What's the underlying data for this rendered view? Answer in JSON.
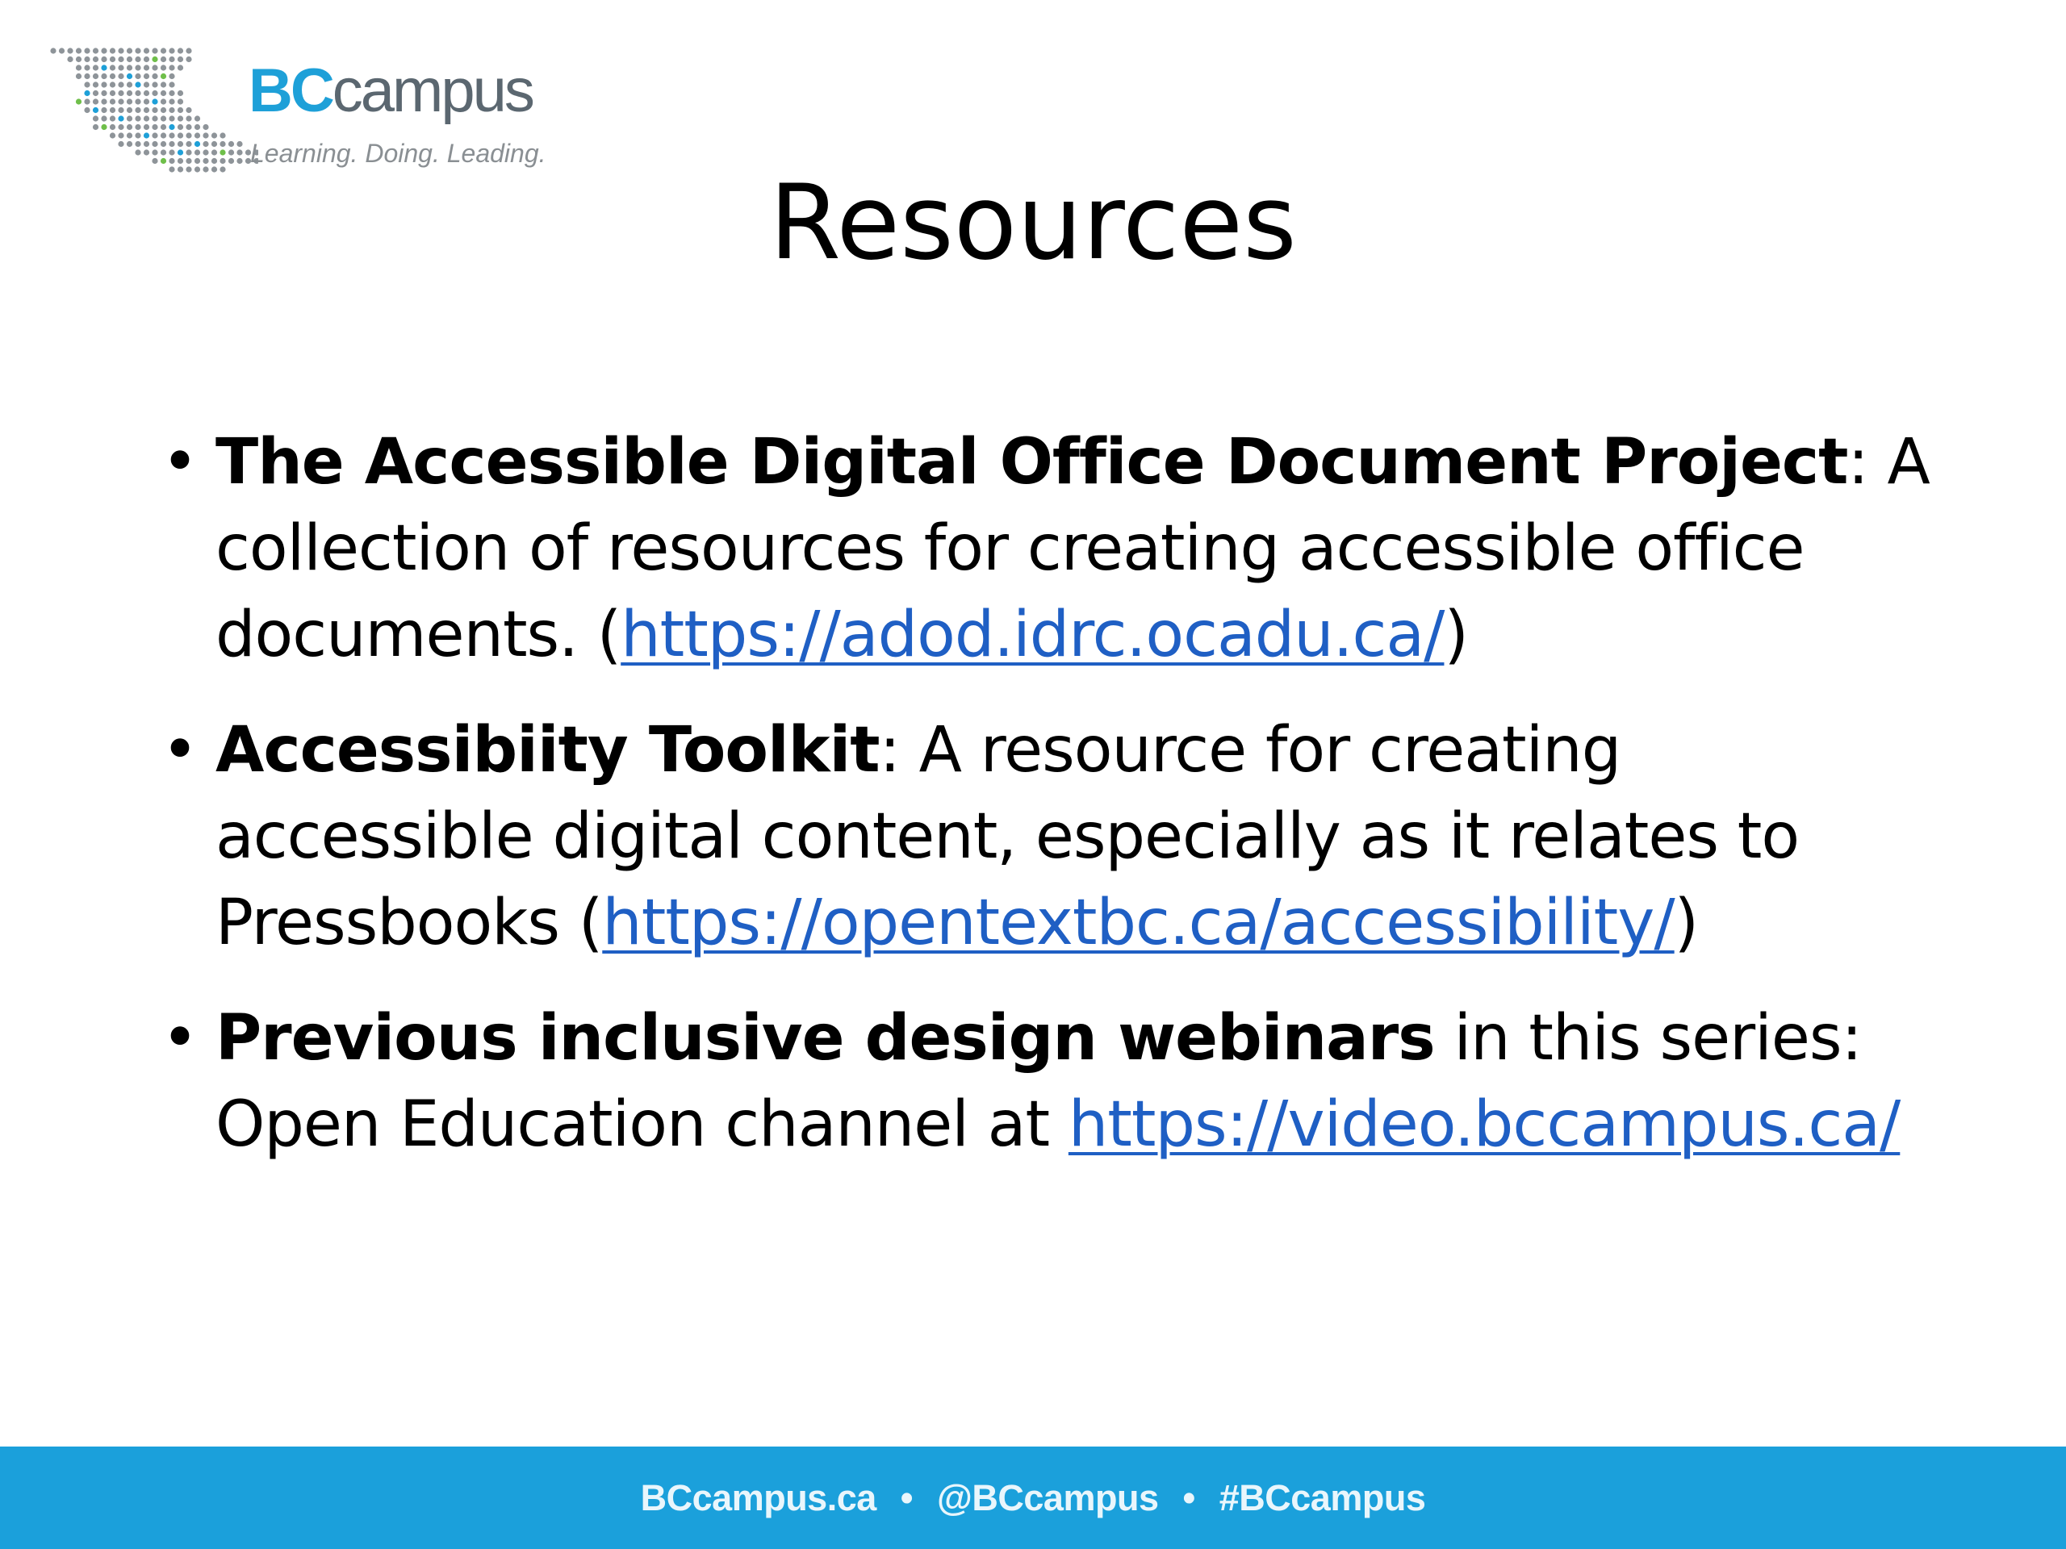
{
  "logo": {
    "brand_bold": "BC",
    "brand_rest": "campus",
    "tagline": "Learning. Doing. Leading."
  },
  "title": "Resources",
  "bullets": [
    {
      "term": "The Accessible Digital Office Document Project",
      "text_before": ": A collection of resources for creating accessible office documents. (",
      "link": "https://adod.idrc.ocadu.ca/",
      "text_after": ")"
    },
    {
      "term": "Accessibiity Toolkit",
      "text_before": ": A resource for creating accessible digital content, especially as it relates to Pressbooks (",
      "link": "https://opentextbc.ca/accessibility/",
      "text_after": ")"
    },
    {
      "term": "Previous inclusive design webinars",
      "text_before": " in this series: Open Education channel at ",
      "link": "https://video.bccampus.ca/",
      "text_after": ""
    }
  ],
  "footer": {
    "site": "BCcampus.ca",
    "handle": "@BCcampus",
    "hashtag": "#BCcampus",
    "separator": "•"
  },
  "colors": {
    "brand_blue": "#1ea0d8",
    "footer_bg": "#1ba0db",
    "link": "#1f5fc4",
    "logo_grey": "#5b6770"
  }
}
